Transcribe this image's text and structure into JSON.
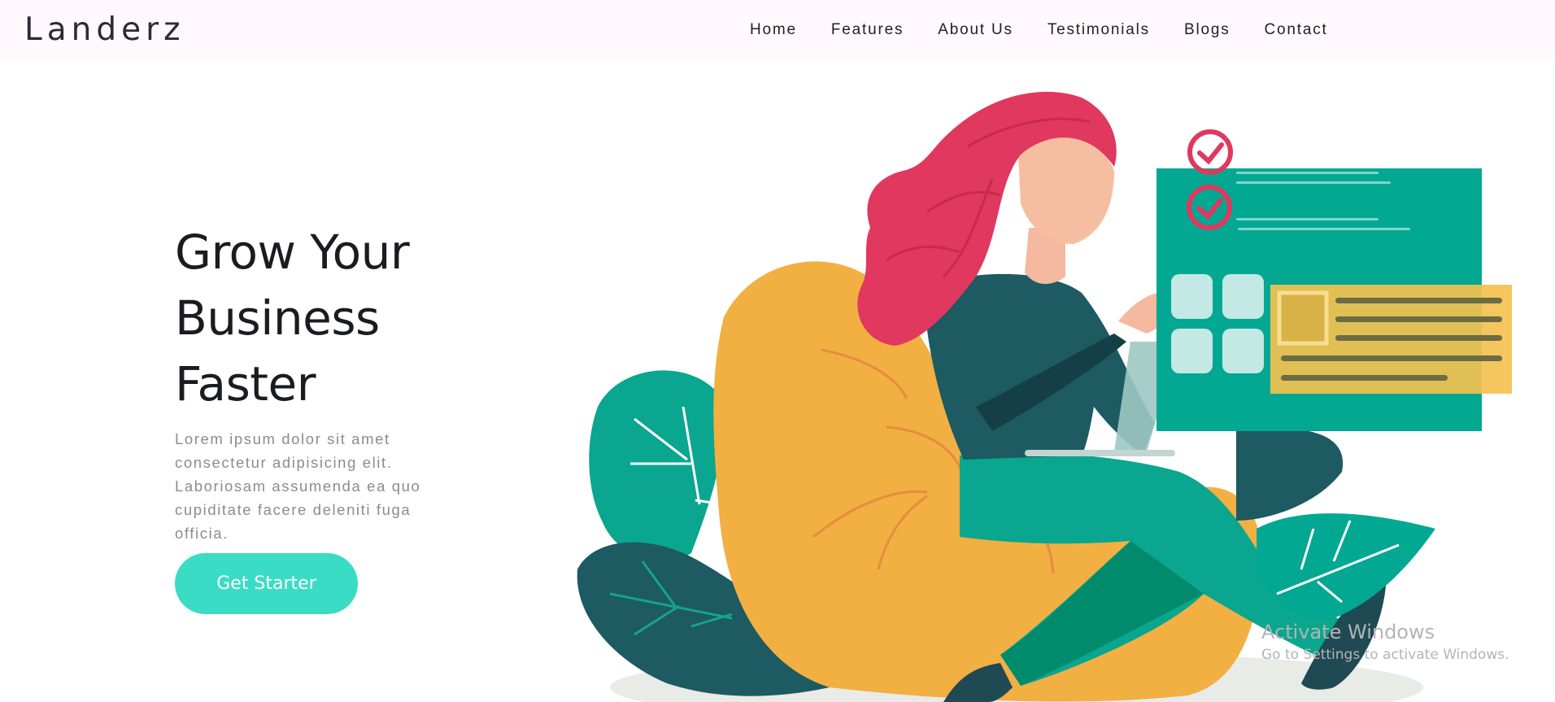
{
  "brand": {
    "name": "Landerz"
  },
  "nav": {
    "links": [
      "Home",
      "Features",
      "About Us",
      "Testimonials",
      "Blogs",
      "Contact"
    ]
  },
  "hero": {
    "title_lines": [
      "Grow Your",
      "Business",
      "Faster"
    ],
    "description": "Lorem ipsum dolor sit amet consectetur adipisicing elit. Laboriosam assumenda ea quo cupiditate facere deleniti fuga officia.",
    "cta_label": "Get Starter"
  },
  "watermark": {
    "title": "Activate Windows",
    "subtitle": "Go to Settings to activate Windows."
  },
  "colors": {
    "navbar_bg": "#fff9fd",
    "accent": "#3bdcc5",
    "teal": "#03a893",
    "dark_teal": "#1d5a62",
    "mustard": "#f2af42",
    "pink": "#e0385f"
  },
  "icons": [
    "check-icon",
    "check-icon"
  ]
}
